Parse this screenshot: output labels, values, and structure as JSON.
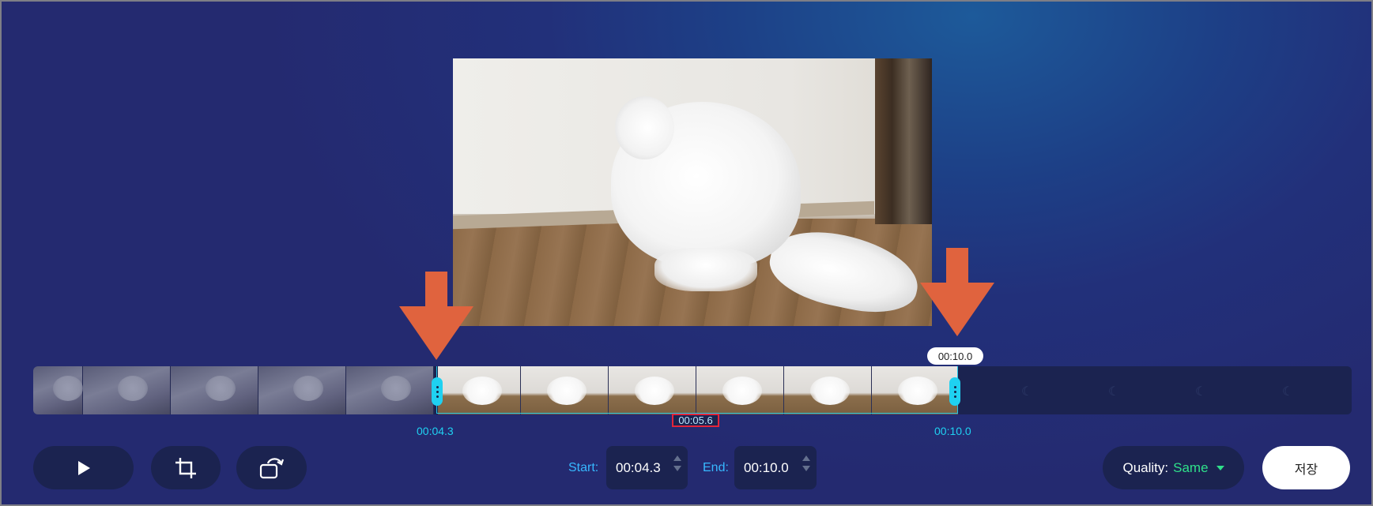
{
  "preview": {
    "icon": "video-frame-cat"
  },
  "timeline": {
    "start_label": "00:04.3",
    "end_label": "00:10.0",
    "playhead_label": "00:05.6",
    "end_tooltip": "00:10.0",
    "selection_start_fraction": 0.287,
    "selection_end_fraction": 0.67
  },
  "controls": {
    "play_icon": "play-icon",
    "crop_icon": "crop-icon",
    "rotate_icon": "rotate-icon"
  },
  "start": {
    "label": "Start:",
    "value": "00:04.3"
  },
  "end": {
    "label": "End:",
    "value": "00:10.0"
  },
  "quality": {
    "label": "Quality:",
    "value": "Same"
  },
  "save_label": "저장",
  "colors": {
    "accent_cyan": "#1fd1f1",
    "arrow_orange": "#e0633e",
    "quality_green": "#2fe08a",
    "highlight_red": "#e3253a",
    "panel_dark": "#1b2350"
  }
}
